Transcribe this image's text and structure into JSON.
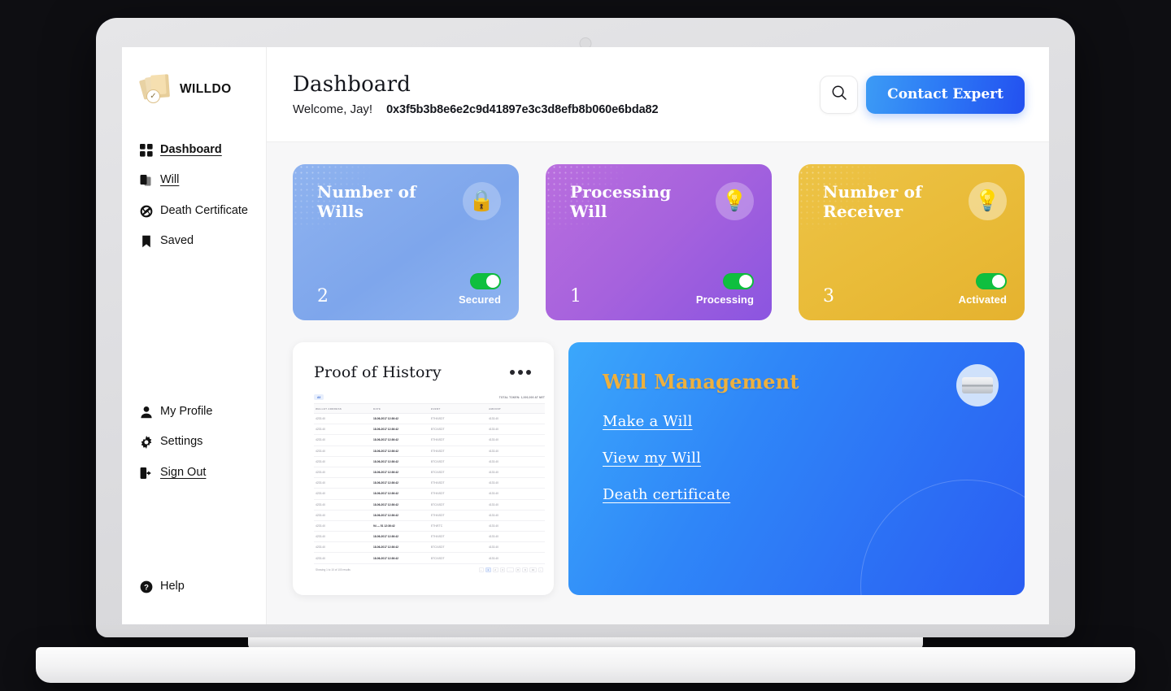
{
  "brand": {
    "name": "WILLDO"
  },
  "sidebar": {
    "primary": [
      {
        "label": "Dashboard",
        "icon": "grid-icon",
        "active": true
      },
      {
        "label": "Will",
        "icon": "documents-icon",
        "active": true
      },
      {
        "label": "Death Certificate",
        "icon": "aperture-icon",
        "active": false
      },
      {
        "label": "Saved",
        "icon": "bookmark-icon",
        "active": false
      }
    ],
    "secondary": [
      {
        "label": "My Profile",
        "icon": "user-icon"
      },
      {
        "label": "Settings",
        "icon": "gear-icon"
      },
      {
        "label": "Sign Out",
        "icon": "sign-out-icon"
      }
    ],
    "help": {
      "label": "Help",
      "icon": "help-circle-icon"
    }
  },
  "header": {
    "title": "Dashboard",
    "welcome": "Welcome, Jay!",
    "wallet_address": "0x3f5b3b8e6e2c9d41897e3c3d8efb8b060e6bda82",
    "search_icon": "search-icon",
    "contact_button": "Contact Expert",
    "contact_accent": "#2d7bf5"
  },
  "stats": [
    {
      "title": "Number of Wills",
      "value": "2",
      "status": "Secured",
      "emoji": "🔒",
      "icon_name": "lock-icon",
      "toggle_on": true,
      "color": "#8fb3ef",
      "theme": "blue"
    },
    {
      "title": "Processing Will",
      "value": "1",
      "status": "Processing",
      "emoji": "💡",
      "icon_name": "lightbulb-icon",
      "toggle_on": true,
      "color": "#a662dd",
      "theme": "purple"
    },
    {
      "title": "Number of Receiver",
      "value": "3",
      "status": "Activated",
      "emoji": "💡",
      "icon_name": "lightbulb-icon",
      "toggle_on": true,
      "color": "#e9bb38",
      "theme": "yellow"
    }
  ],
  "proof_of_history": {
    "title": "Proof of History",
    "menu_icon": "more-horizontal-icon",
    "filter_chip": "All",
    "total_label": "TOTAL TOKEN: 1,000,000 AT NET",
    "columns": [
      "WALLET ADDRESS",
      "DATE",
      "EVENT",
      "AMOUNT"
    ],
    "rows": [
      [
        "4233.40",
        "18-06-2017 12:36:42",
        "ETH/USDT",
        "4133.40"
      ],
      [
        "4233.40",
        "18-06-2017 12:36:42",
        "BTC/USDT",
        "4133.40"
      ],
      [
        "4233.40",
        "18-06-2017 12:36:42",
        "ETH/USDT",
        "4133.40"
      ],
      [
        "4233.40",
        "18-06-2017 12:36:42",
        "ETH/USDT",
        "4133.40"
      ],
      [
        "4233.40",
        "18-06-2017 12:36:42",
        "BTC/USDT",
        "4133.40"
      ],
      [
        "4233.40",
        "18-06-2017 12:36:42",
        "BTC/USDT",
        "4133.40"
      ],
      [
        "4233.40",
        "18-06-2017 12:36:42",
        "ETH/USDT",
        "4133.40"
      ],
      [
        "4233.40",
        "18-06-2017 12:36:42",
        "ETH/USDT",
        "4133.40"
      ],
      [
        "4233.40",
        "18-06-2017 12:36:42",
        "BTC/USDT",
        "4133.40"
      ],
      [
        "4233.40",
        "18-06-2017 12:36:42",
        "ETH/USDT",
        "4133.40"
      ],
      [
        "4233.40",
        "94 — 51  12:36:42",
        "ETH/ETC",
        "4133.40"
      ],
      [
        "4233.40",
        "18-06-2017 12:36:42",
        "ETH/USDT",
        "4133.40"
      ],
      [
        "4233.40",
        "18-06-2017 12:36:42",
        "BTC/USDT",
        "4133.40"
      ],
      [
        "4233.40",
        "18-06-2017 12:36:42",
        "BTC/USDT",
        "4133.40"
      ]
    ],
    "footer_text": "Showing 1 to 10 of 100 results",
    "pages": [
      "‹",
      "1",
      "2",
      "3",
      "…",
      "8",
      "9",
      "10",
      "›"
    ],
    "active_page": "1"
  },
  "will_management": {
    "title": "Will Management",
    "title_color": "#edb03e",
    "avatar_icon": "id-card-icon",
    "links": [
      {
        "label": "Make a Will"
      },
      {
        "label": "View  my Will"
      },
      {
        "label": "Death certificate"
      }
    ]
  }
}
